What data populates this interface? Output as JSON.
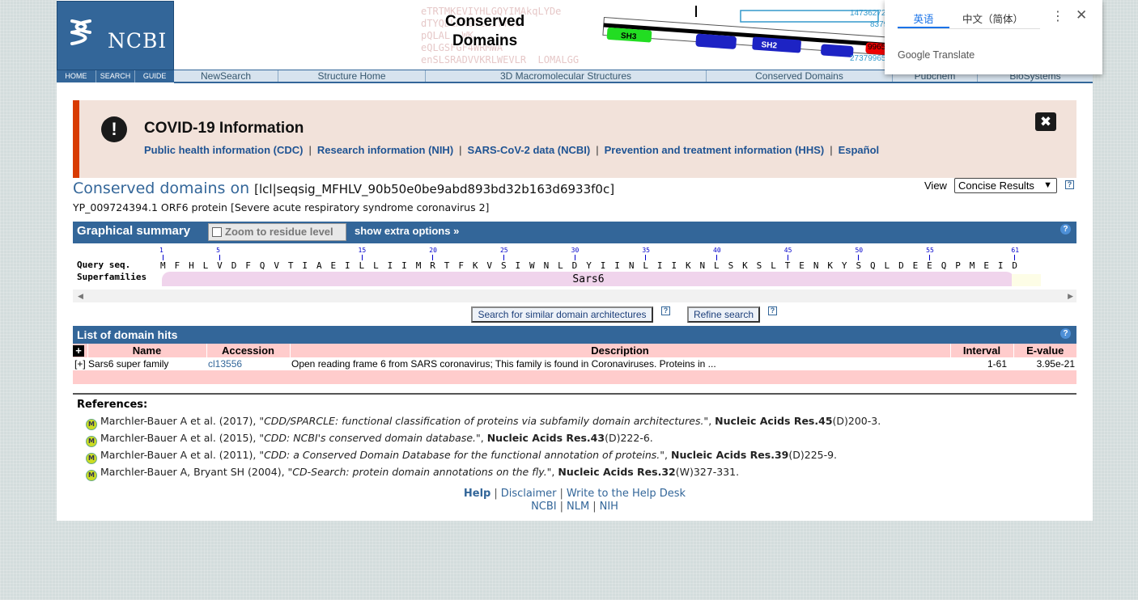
{
  "header": {
    "logo_text": "NCBI",
    "logo_links": [
      "HOME",
      "SEARCH",
      "GUIDE"
    ],
    "banner_title_line1": "Conserved",
    "banner_title_line2": "Domains",
    "banner_seq": "eTRTMKEVIYHLGQYIMAkqLYDe\ndTYQDLMKeYlKIYfLC\npQLAL  WK\neQLGSFGF4WRMWA\nenSLSRADVVKRLWEVLR  LOMALGG",
    "banner_numbers": [
      "14736272[0/",
      "8379/",
      "9965",
      "27379965"
    ],
    "banner_labels": [
      "SH3",
      "SH2"
    ],
    "nav": [
      "NewSearch",
      "Structure Home",
      "3D Macromolecular Structures",
      "Conserved Domains",
      "Pubchem",
      "BioSystems"
    ]
  },
  "covid": {
    "icon": "!",
    "title": "COVID-19 Information",
    "links": [
      "Public health information (CDC)",
      "Research information (NIH)",
      "SARS-CoV-2 data (NCBI)",
      "Prevention and treatment information (HHS)",
      "Español"
    ],
    "close": "✖"
  },
  "heading": {
    "title": "Conserved domains on",
    "query_id": "[lcl|seqsig_MFHLV_90b50e0be9abd893bd32b163d6933f0c]",
    "subtitle": "YP_009724394.1 ORF6 protein [Severe acute respiratory syndrome coronavirus 2]",
    "view_label": "View",
    "view_value": "Concise Results"
  },
  "graphical_summary": {
    "title": "Graphical summary",
    "zoom_label": "Zoom to residue level",
    "zoom_checked": false,
    "extra_options": "show extra options »",
    "query_label": "Query seq.",
    "superfamilies_label": "Superfamilies",
    "ruler_ticks": [
      "1",
      "5",
      "15",
      "20",
      "25",
      "30",
      "35",
      "40",
      "45",
      "50",
      "55",
      "61"
    ],
    "sequence": "MFHLVDFQVTIAEILLIIMRTFKVSIWNLDYIINLIIKNLSKSLTENKYSQLDEEQPMEID",
    "superfamily_name": "Sars6"
  },
  "buttons": {
    "search_similar": "Search for similar domain architectures",
    "refine": "Refine search"
  },
  "domain_hits": {
    "title": "List of domain hits",
    "expand_all": "+",
    "columns": [
      "Name",
      "Accession",
      "Description",
      "Interval",
      "E-value"
    ],
    "rows": [
      {
        "expand": "[+]",
        "name": "Sars6 super family",
        "accession": "cl13556",
        "description": "Open reading frame 6 from SARS coronavirus; This family is found in Coronaviruses. Proteins in ...",
        "interval": "1-61",
        "evalue": "3.95e-21"
      }
    ]
  },
  "references": {
    "heading": "References:",
    "items": [
      {
        "authors": "Marchler-Bauer A et al. (2017), ",
        "title": "\"CDD/SPARCLE: functional classification of proteins via subfamily domain architectures.\"",
        "journal": "Nucleic Acids Res.45",
        "pages": "(D)200-3."
      },
      {
        "authors": "Marchler-Bauer A et al. (2015), ",
        "title": "\"CDD: NCBI's conserved domain database.\"",
        "journal": "Nucleic Acids Res.43",
        "pages": "(D)222-6."
      },
      {
        "authors": "Marchler-Bauer A et al. (2011), ",
        "title": "\"CDD: a Conserved Domain Database for the functional annotation of proteins.\"",
        "journal": "Nucleic Acids Res.39",
        "pages": "(D)225-9."
      },
      {
        "authors": "Marchler-Bauer A, Bryant SH (2004), ",
        "title": "\"CD-Search: protein domain annotations on the fly.\"",
        "journal": "Nucleic Acids Res.32",
        "pages": "(W)327-331."
      }
    ]
  },
  "footer": {
    "help": "Help",
    "disclaimer": "Disclaimer",
    "write": "Write to the Help Desk",
    "ncbi": "NCBI",
    "nlm": "NLM",
    "nih": "NIH"
  },
  "translate_popup": {
    "tab_active": "英语",
    "tab_other": "中文（简体）",
    "brand": "Google Translate"
  },
  "colors": {
    "brand_blue": "#336699",
    "covid_accent": "#d83b01",
    "hits_header": "#ffcccc",
    "superfamily_fill": "#f0d4ec"
  }
}
